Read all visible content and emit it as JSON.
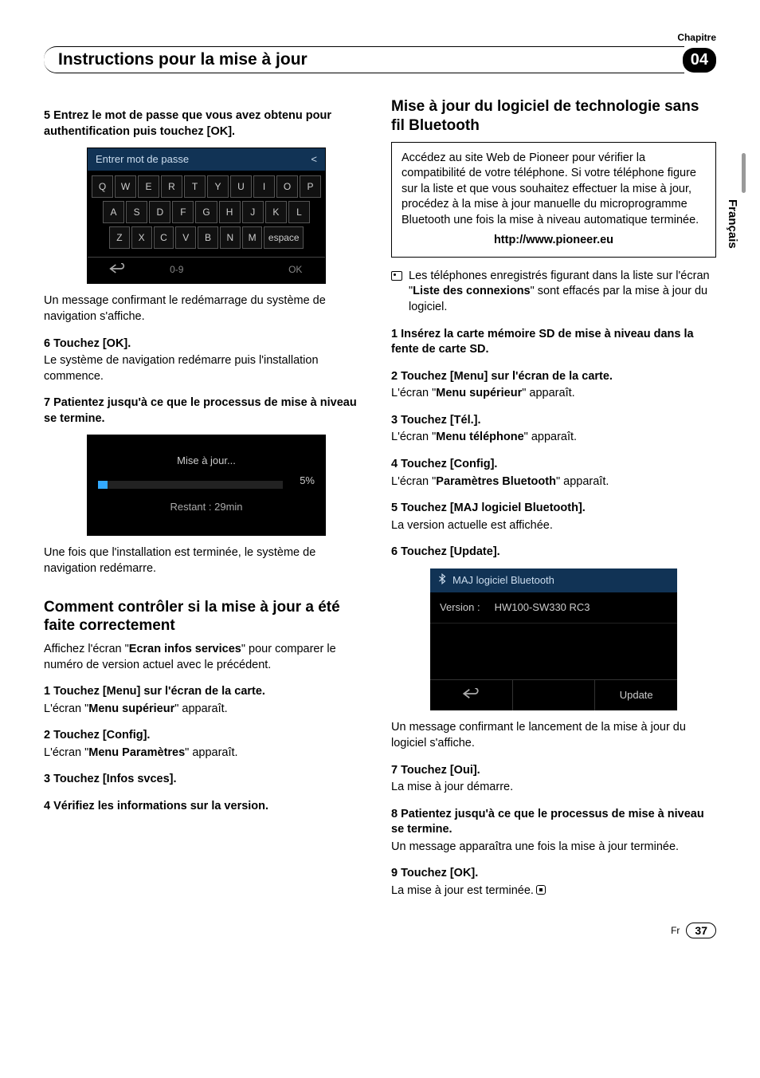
{
  "header": {
    "chapter_label": "Chapitre",
    "title": "Instructions pour la mise à jour",
    "chapter_num": "04"
  },
  "lang_tab": "Français",
  "left": {
    "step5_head": "5    Entrez le mot de passe que vous avez obtenu pour authentification puis touchez [OK].",
    "kb": {
      "title": "Entrer mot de passe",
      "close": "<",
      "row1": [
        "Q",
        "W",
        "E",
        "R",
        "T",
        "Y",
        "U",
        "I",
        "O",
        "P"
      ],
      "row2": [
        "A",
        "S",
        "D",
        "F",
        "G",
        "H",
        "J",
        "K",
        "L"
      ],
      "row3": [
        "Z",
        "X",
        "C",
        "V",
        "B",
        "N",
        "M",
        "espace"
      ],
      "bottom_num": "0-9",
      "bottom_ok": "OK"
    },
    "after_kb": "Un message confirmant le redémarrage du système de navigation s'affiche.",
    "step6_head": "6    Touchez [OK].",
    "step6_body": "Le système de navigation redémarre puis l'installation commence.",
    "step7_head": "7    Patientez jusqu'à ce que le processus de mise à niveau se termine.",
    "progress": {
      "title": "Mise à jour...",
      "pct": "5%",
      "remaining": "Restant   :   29min"
    },
    "after_prog": "Une fois que l'installation est terminée, le système de navigation redémarre.",
    "h2": "Comment contrôler si la mise à jour a été faite correctement",
    "intro_a": "Affichez l'écran \"",
    "intro_bold": "Ecran infos services",
    "intro_b": "\" pour comparer le numéro de version actuel avec le précédent.",
    "c1_head": "1    Touchez [Menu] sur l'écran de la carte.",
    "c1_body_a": "L'écran \"",
    "c1_body_bold": "Menu supérieur",
    "c1_body_b": "\" apparaît.",
    "c2_head": "2    Touchez [Config].",
    "c2_body_a": "L'écran \"",
    "c2_body_bold": "Menu Paramètres",
    "c2_body_b": "\" apparaît.",
    "c3_head": "3    Touchez [Infos svces].",
    "c4_head": "4    Vérifiez les informations sur la version."
  },
  "right": {
    "h2": "Mise à jour du logiciel de technologie sans fil Bluetooth",
    "box_text": "Accédez au site Web de Pioneer pour vérifier la compatibilité de votre téléphone. Si votre téléphone figure sur la liste et que vous souhaitez effectuer la mise à jour, procédez à la mise à jour manuelle du microprogramme Bluetooth une fois la mise à niveau automatique terminée.",
    "box_url": "http://www.pioneer.eu",
    "note_a": "Les téléphones enregistrés figurant dans la liste sur l'écran \"",
    "note_bold": "Liste des connexions",
    "note_b": "\" sont effacés par la mise à jour du logiciel.",
    "s1_head": "1    Insérez la carte mémoire SD de mise à niveau dans la fente de carte SD.",
    "s2_head": "2    Touchez [Menu] sur l'écran de la carte.",
    "s2_body_a": "L'écran \"",
    "s2_body_bold": "Menu supérieur",
    "s2_body_b": "\" apparaît.",
    "s3_head": "3    Touchez [Tél.].",
    "s3_body_a": "L'écran \"",
    "s3_body_bold": "Menu téléphone",
    "s3_body_b": "\" apparaît.",
    "s4_head": "4    Touchez [Config].",
    "s4_body_a": "L'écran \"",
    "s4_body_bold": "Paramètres Bluetooth",
    "s4_body_b": "\" apparaît.",
    "s5_head": "5    Touchez [MAJ logiciel Bluetooth].",
    "s5_body": "La version actuelle est affichée.",
    "s6_head": "6    Touchez [Update].",
    "bt": {
      "title": "MAJ logiciel Bluetooth",
      "version_label": "Version :",
      "version_value": "HW100-SW330 RC3",
      "update": "Update"
    },
    "after_bt": "Un message confirmant le lancement de la mise à jour du logiciel s'affiche.",
    "s7_head": "7    Touchez [Oui].",
    "s7_body": "La mise à jour démarre.",
    "s8_head": "8    Patientez jusqu'à ce que le processus de mise à niveau se termine.",
    "s8_body": "Un message apparaîtra une fois la mise à jour terminée.",
    "s9_head": "9    Touchez [OK].",
    "s9_body": "La mise à jour est terminée."
  },
  "footer": {
    "lang": "Fr",
    "page": "37"
  }
}
